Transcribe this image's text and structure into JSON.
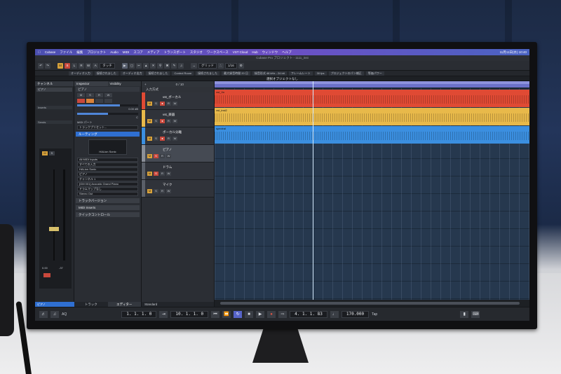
{
  "menubar": {
    "apple": "",
    "items": [
      "Cubase",
      "ファイル",
      "編集",
      "プロジェクト",
      "Audio",
      "MIDI",
      "スコア",
      "メディア",
      "トランスポート",
      "スタジオ",
      "ワークスペース",
      "VST Cloud",
      "Hub",
      "ウィンドウ",
      "ヘルプ"
    ],
    "clock": "11月11日(水) 10:40"
  },
  "window_title": "Cubase Pro プロジェクト - 1111_inst",
  "toolbar": {
    "m": "M",
    "s": "S",
    "l": "L",
    "r": "R",
    "w": "W",
    "a": "A",
    "mode": "タッチ",
    "grid": "グリッド",
    "quantize": "1/16"
  },
  "status": [
    "オーディオ入力",
    "接続されました",
    "オーディオ出力",
    "接続されました",
    "Control Room",
    "接続されました",
    "最大録音時間 20 日",
    "録音形式 48 kHz - 24 bit",
    "フレームレート",
    "30 fps",
    "プロジェクトのパン補正",
    "等価パワー"
  ],
  "info_line": "選択オブジェクトなし",
  "left_zone": {
    "tab": "チャンネル",
    "channel": "ピアノ",
    "sections": [
      "Inserts",
      "Sends"
    ],
    "vol_left": "0.00",
    "vol_right": "-37",
    "name": "ピアノ",
    "m": "M",
    "s": "S"
  },
  "inspector": {
    "tabs": [
      "Inspector",
      "Visibility"
    ],
    "track_name": "ピアノ",
    "btns": [
      "M",
      "S",
      "R",
      "W"
    ],
    "vol": "0.00 dB",
    "pan": "C",
    "midi_part": "MIDI パート",
    "track_preset": "トラックプリセット...",
    "routing_label": "ルーティング",
    "instrument": "HALion Sonic",
    "input": "All MIDI Inputs",
    "input_sub": "すべての入力",
    "output": "HALion Sonic",
    "output_sub": "ピアノ",
    "channel": "チャンネル 1",
    "patch": "[GM 001] Acoustic Grand Piano",
    "drummap": "ドラムマップなし",
    "stereo_out": "Stereo Out",
    "sections": [
      "トラックバージョン",
      "MIDI Inserts",
      "クイックコントロール"
    ],
    "footer": [
      "トラック",
      "エディター"
    ]
  },
  "tracklist": {
    "counter": "0 / 10",
    "folder": "入力方式",
    "tracks": [
      {
        "name": "vst_ボーカル",
        "color": "#e04a34"
      },
      {
        "name": "vst_楽器",
        "color": "#e8b94a"
      },
      {
        "name": "ボーカル分離",
        "color": "#3b8fe0"
      },
      {
        "name": "ピアノ",
        "color": "#3a3e45"
      },
      {
        "name": "ドラム",
        "color": "#3a3e45"
      },
      {
        "name": "マイク",
        "color": "#3a3e45"
      }
    ],
    "footer": "Standard"
  },
  "lanes": [
    {
      "label": "vst_Vo",
      "color": "#e04a34"
    },
    {
      "label": "vst_inst2",
      "color": "#e8b94a"
    },
    {
      "label": "spectral",
      "color": "#3b8fe0"
    }
  ],
  "transport": {
    "left_locator": "1. 1. 1. 0",
    "right_locator": "10. 1. 1. 0",
    "position": "4. 1. 1. 83",
    "tempo": "170.000",
    "sig": "Tap",
    "aq": "AQ"
  }
}
